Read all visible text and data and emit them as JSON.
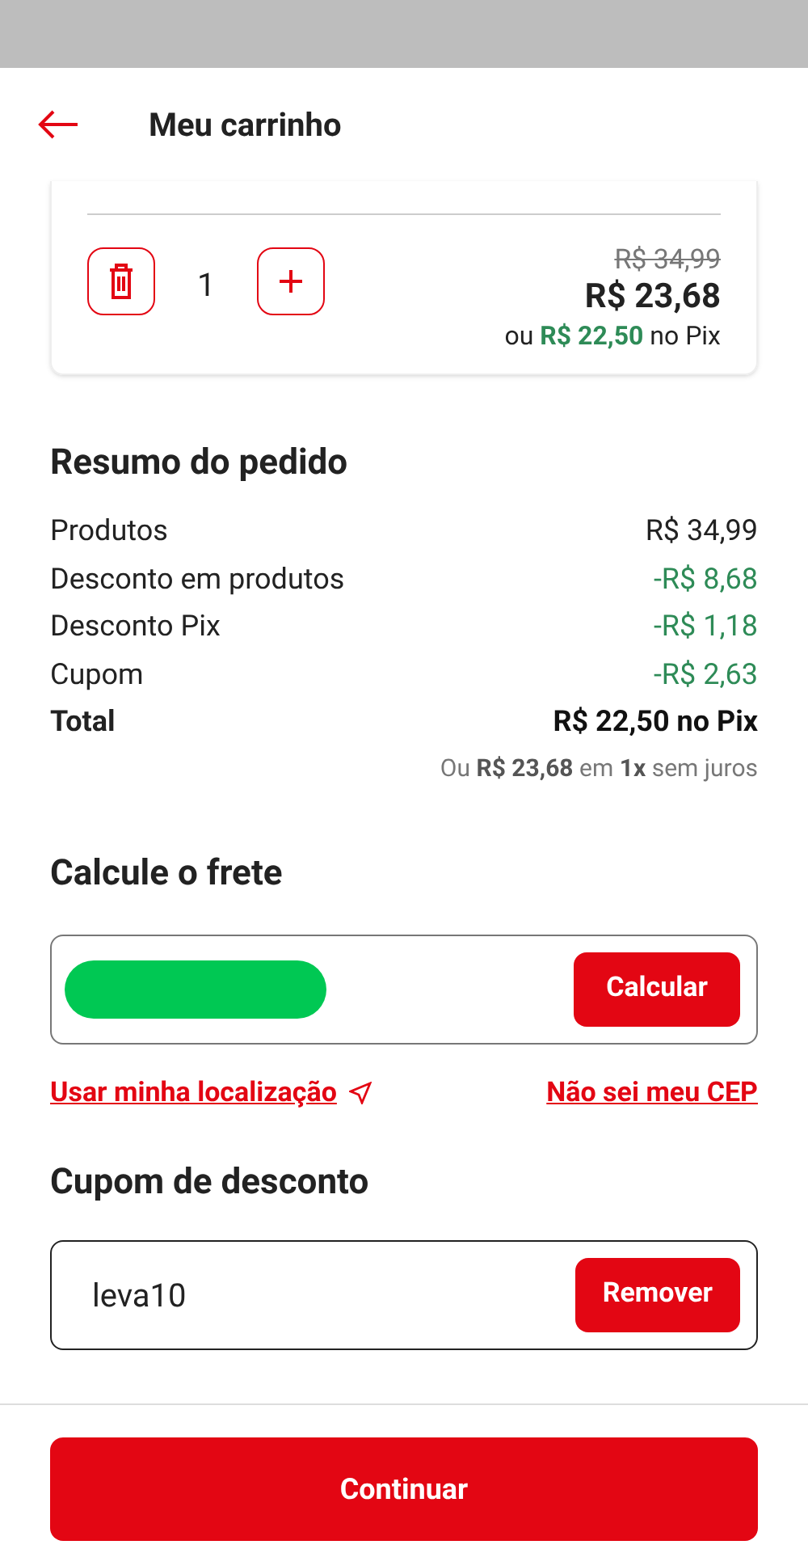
{
  "header": {
    "title": "Meu carrinho"
  },
  "cart_item": {
    "quantity": "1",
    "old_price": "R$ 34,99",
    "price": "R$ 23,68",
    "pix_note": "ou **R$ 22,50** no Pix"
  },
  "summary": {
    "title": "Resumo do pedido",
    "rows": [
      {
        "label": "Produtos",
        "value": "R$ 34,99",
        "kind": "normal"
      },
      {
        "label": "Desconto em produtos",
        "value": "-R$ 8,68",
        "kind": "discount"
      },
      {
        "label": "Desconto Pix",
        "value": "-R$ 1,18",
        "kind": "discount"
      },
      {
        "label": "Cupom",
        "value": "-R$ 2,63",
        "kind": "discount"
      },
      {
        "label": "Total",
        "value": "R$ 22,50 no Pix",
        "kind": "total"
      }
    ],
    "installments": "Ou **R$ 23,68** em **1x** sem juros"
  },
  "shipping": {
    "title": "Calcule o frete",
    "button": "Calcular",
    "links": [
      "Usar minha localização",
      "Não sei meu CEP"
    ]
  },
  "coupon": {
    "title": "Cupom de desconto",
    "value": "leva10",
    "button": "Remover"
  },
  "footer": {
    "button": "Continuar"
  }
}
